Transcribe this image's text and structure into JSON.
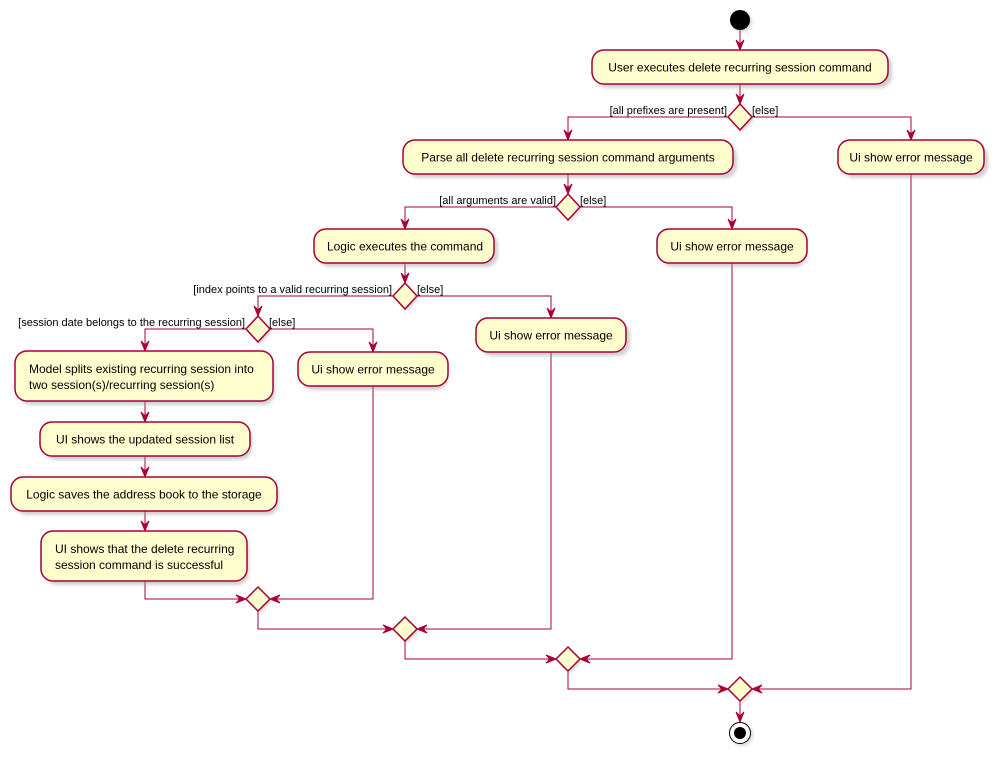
{
  "diagram": {
    "type": "activity",
    "colors": {
      "node_fill": "#FEFECE",
      "border": "#A80036",
      "start_end": "#000000"
    },
    "start": {
      "label": "start"
    },
    "end": {
      "label": "end"
    },
    "actions": {
      "user_executes": "User executes delete recurring session command",
      "parse_args": "Parse all delete recurring session command arguments",
      "error_prefixes": "Ui show error message",
      "logic_executes": "Logic executes the command",
      "error_args": "Ui show error message",
      "error_index": "Ui show error message",
      "error_date": "Ui show error message",
      "model_splits_line1": "Model splits existing recurring session into",
      "model_splits_line2": "two session(s)/recurring session(s)",
      "ui_updated": "UI shows the updated session list",
      "logic_saves": "Logic saves the address book to the storage",
      "ui_success_line1": "UI shows that the delete recurring",
      "ui_success_line2": "session  command is successful"
    },
    "guards": {
      "prefixes_present": "[all prefixes are present]",
      "prefixes_else": "[else]",
      "args_valid": "[all arguments are valid]",
      "args_else": "[else]",
      "index_valid": "[index points to a valid recurring session]",
      "index_else": "[else]",
      "date_belongs": "[session date belongs to the recurring session]",
      "date_else": "[else]"
    }
  }
}
